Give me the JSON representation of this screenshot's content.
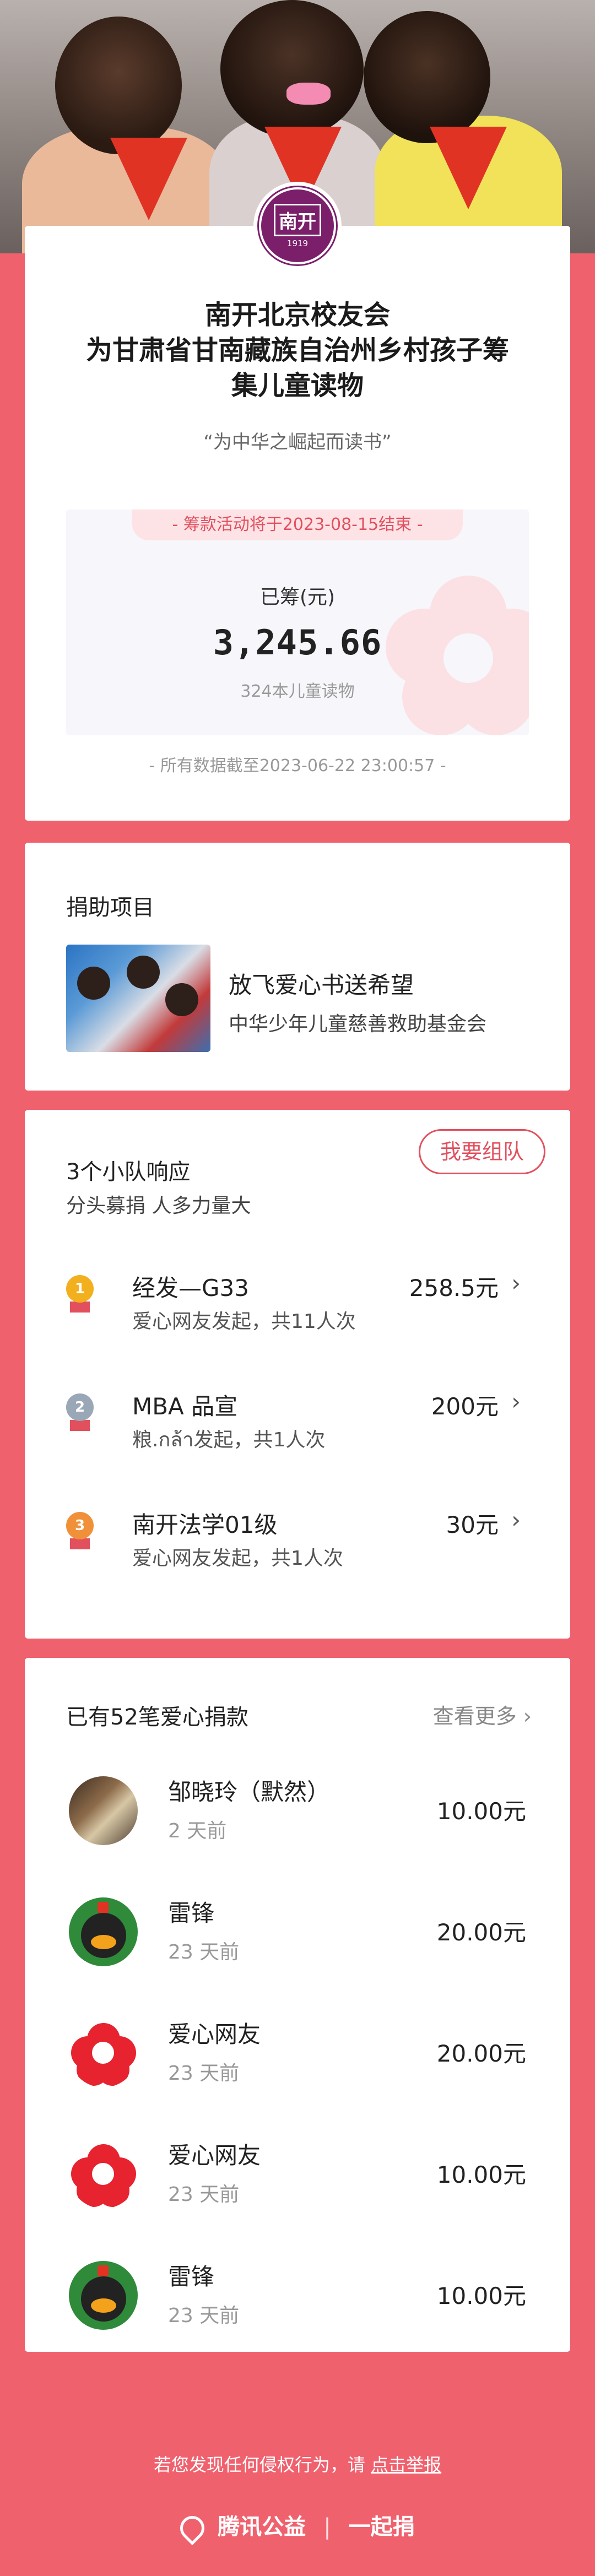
{
  "campaign": {
    "organizer": "南开北京校友会",
    "title_line2": "为甘肃省甘南藏族自治州乡村孩子筹",
    "title_line3": "集儿童读物",
    "slogan": "“为中华之崛起而读书”",
    "deadline": "- 筹款活动将于2023-08-15结束 -",
    "raised_label": "已筹(元)",
    "raised_amount": "3,245.66",
    "books": "324本儿童读物",
    "as_of": "- 所有数据截至2023-06-22 23:00:57 -",
    "logo_text": "南开",
    "logo_year": "1919"
  },
  "project": {
    "section_title": "捐助项目",
    "name": "放飞爱心书送希望",
    "org": "中华少年儿童慈善救助基金会"
  },
  "teams": {
    "title": "3个小队响应",
    "subtitle": "分头募捐 人多力量大",
    "button": "我要组队",
    "items": [
      {
        "rank": "1",
        "name": "经发—G33",
        "info": "爱心网友发起，共11人次",
        "amount": "258.5元",
        "color": "#f2b01e"
      },
      {
        "rank": "2",
        "name": "MBA 品宣",
        "info": "粮.กล้า发起，共1人次",
        "amount": "200元",
        "color": "#9aa7b6"
      },
      {
        "rank": "3",
        "name": "南开法学01级",
        "info": "爱心网友发起，共1人次",
        "amount": "30元",
        "color": "#f0913a"
      }
    ]
  },
  "donations": {
    "title": "已有52笔爱心捐款",
    "more": "查看更多",
    "items": [
      {
        "name": "邹晓玲（默然）",
        "time": "2 天前",
        "amount": "10.00元",
        "avatar": "photo"
      },
      {
        "name": "雷锋",
        "time": "23 天前",
        "amount": "20.00元",
        "avatar": "penguin"
      },
      {
        "name": "爱心网友",
        "time": "23 天前",
        "amount": "20.00元",
        "avatar": "flower"
      },
      {
        "name": "爱心网友",
        "time": "23 天前",
        "amount": "10.00元",
        "avatar": "flower"
      },
      {
        "name": "雷锋",
        "time": "23 天前",
        "amount": "10.00元",
        "avatar": "penguin"
      }
    ]
  },
  "footer": {
    "note_prefix": "若您发现任何侵权行为，请",
    "report_link": "点击举报",
    "brand_left": "腾讯公益",
    "brand_right": "一起捐"
  },
  "colors": {
    "background": "#f0616e",
    "accent": "#e2505e",
    "logo": "#7b1f6b"
  }
}
